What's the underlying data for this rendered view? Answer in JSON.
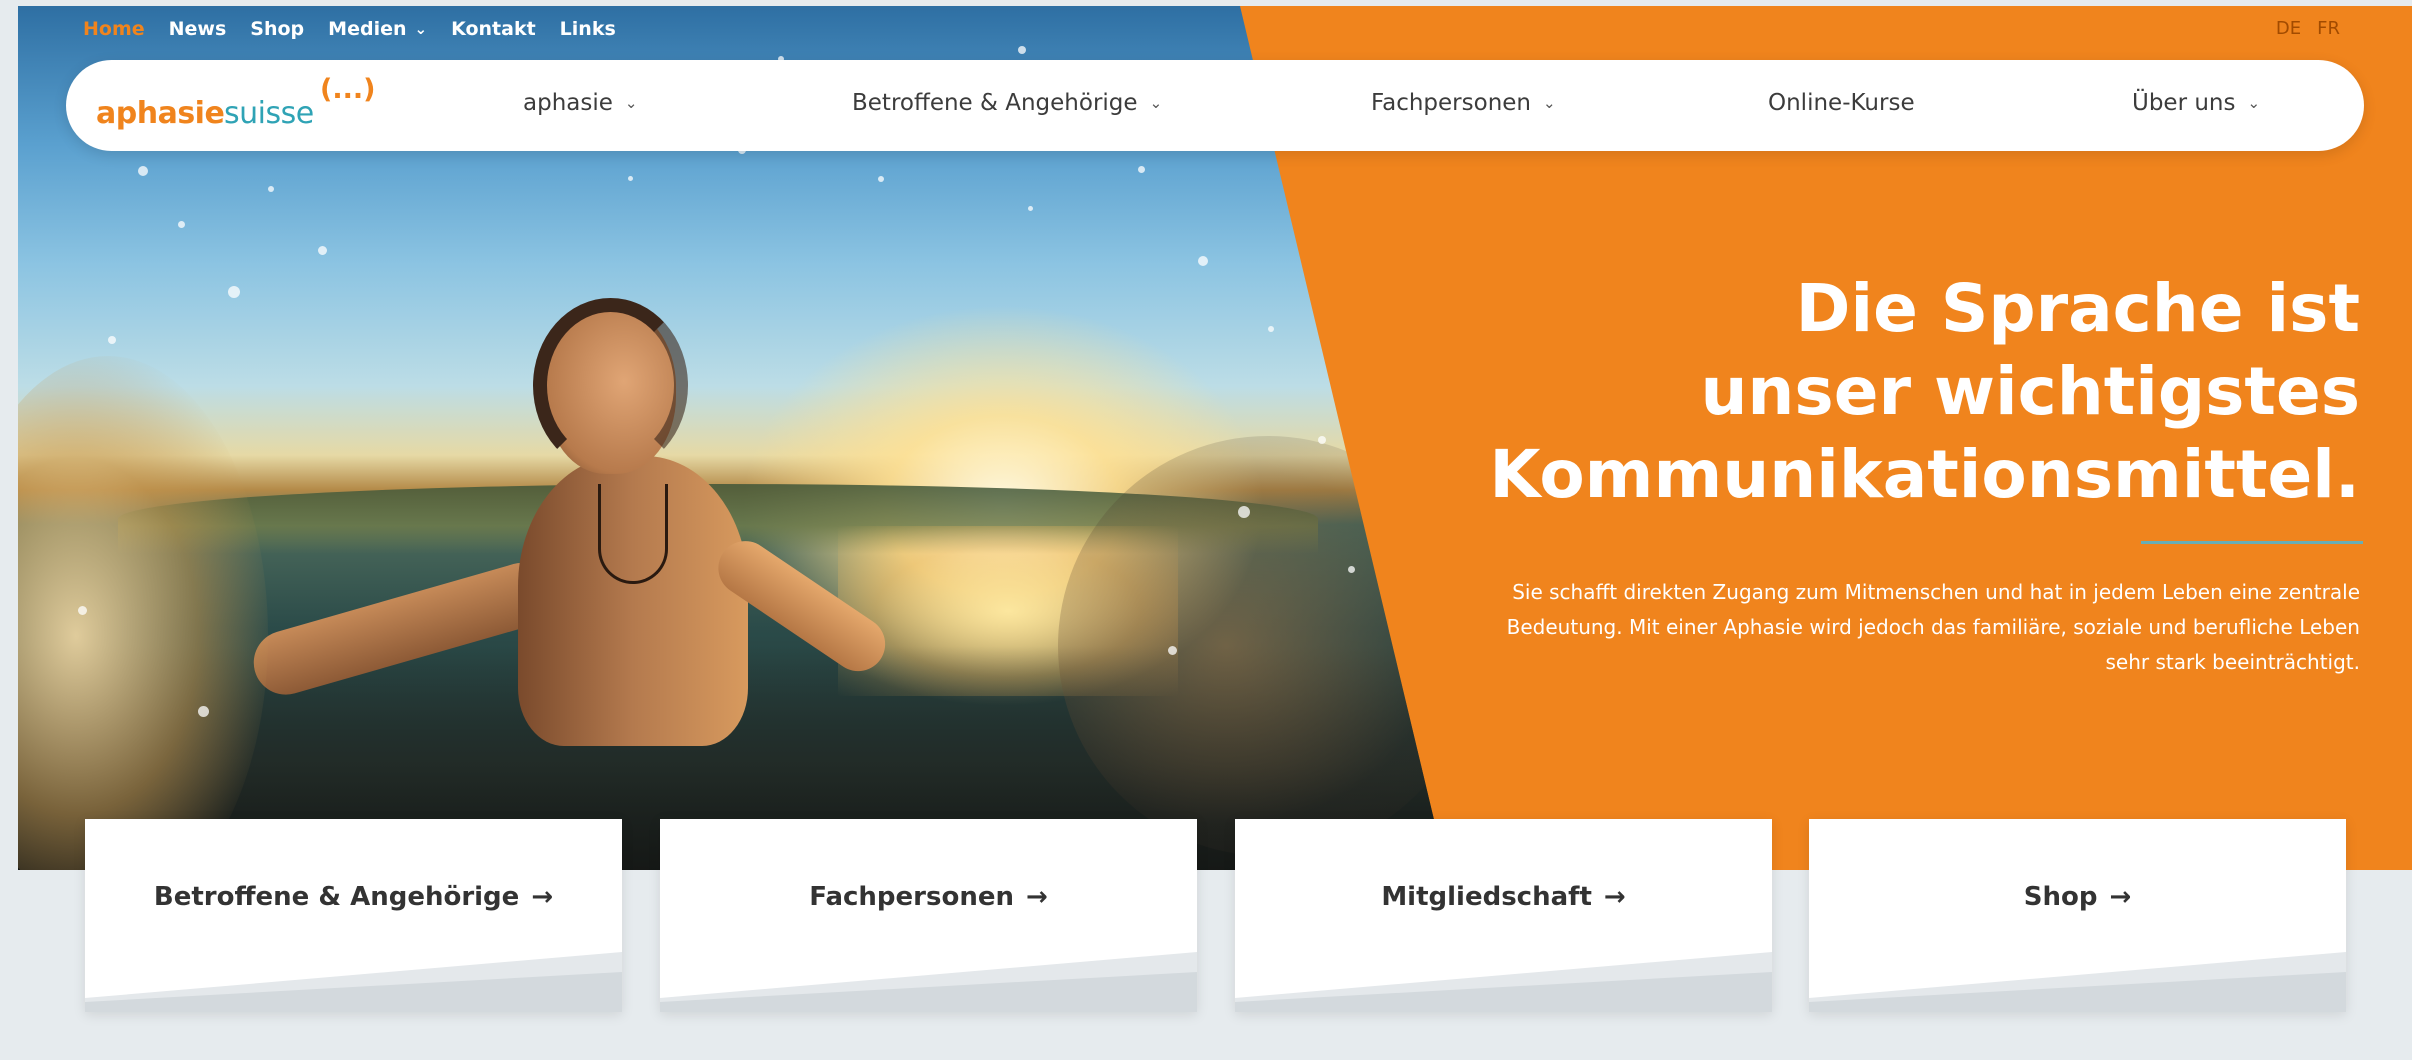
{
  "colors": {
    "brand_orange": "#f0841d",
    "brand_teal": "#2fa3b5",
    "accent_rule": "#69aeb4",
    "page_bg": "#e6ebee",
    "nav_text": "#3c3c3c"
  },
  "topbar": {
    "links": [
      {
        "label": "Home",
        "active": true
      },
      {
        "label": "News"
      },
      {
        "label": "Shop"
      },
      {
        "label": "Medien",
        "dropdown": true
      },
      {
        "label": "Kontakt"
      },
      {
        "label": "Links"
      }
    ],
    "languages": [
      "DE",
      "FR"
    ]
  },
  "logo": {
    "word1": "aphasie",
    "word2": "suisse",
    "mark": "(...)"
  },
  "mainnav": {
    "items": [
      {
        "label": "aphasie",
        "dropdown": true
      },
      {
        "label": "Betroffene & Angehörige",
        "dropdown": true
      },
      {
        "label": "Fachpersonen",
        "dropdown": true
      },
      {
        "label": "Online-Kurse",
        "dropdown": false
      },
      {
        "label": "Über uns",
        "dropdown": true
      }
    ],
    "chevron_icon": "chevron-down-icon"
  },
  "hero": {
    "headline": [
      "Die Sprache ist",
      "unser wichtigstes",
      "Kommunikationsmittel."
    ],
    "lead": "Sie schafft direkten Zugang zum Mitmenschen und hat in jedem Leben eine zentrale Bedeutung. Mit einer Aphasie wird jedoch das familiäre, soziale und berufliche Leben sehr stark beeinträchtigt."
  },
  "cards": [
    {
      "label": "Betroffene & Angehörige",
      "icon": "arrow-right-icon"
    },
    {
      "label": "Fachpersonen",
      "icon": "arrow-right-icon"
    },
    {
      "label": "Mitgliedschaft",
      "icon": "arrow-right-icon"
    },
    {
      "label": "Shop",
      "icon": "arrow-right-icon"
    }
  ],
  "glyphs": {
    "chevron": "⌄",
    "arrow": "→"
  }
}
